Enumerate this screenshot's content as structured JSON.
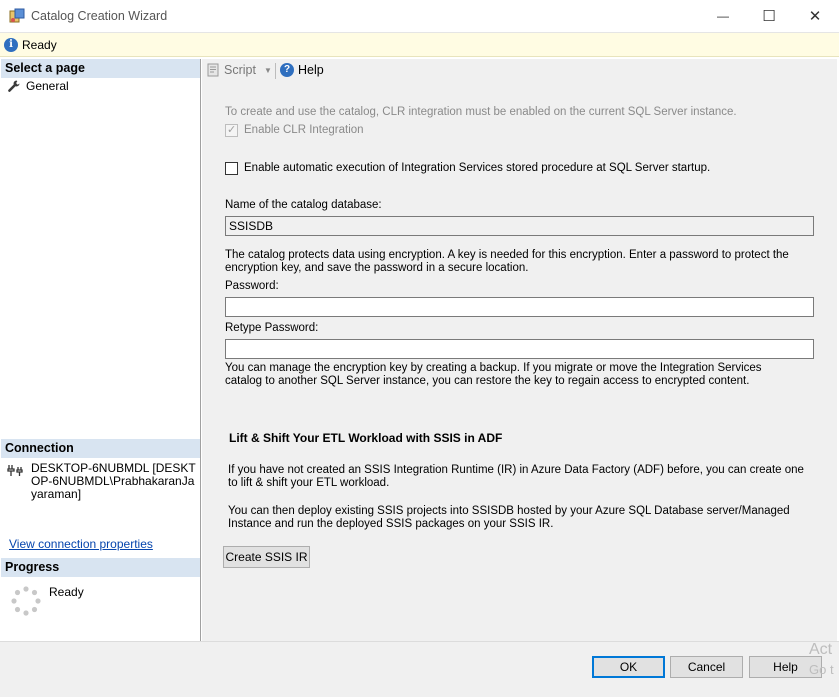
{
  "window": {
    "title": "Catalog Creation Wizard",
    "minimize_glyph": "—",
    "maximize_glyph": "☐",
    "close_glyph": "✕"
  },
  "status_bar": {
    "text": "Ready",
    "icon": "info-icon"
  },
  "left_pane": {
    "select_page_header": "Select a page",
    "pages": [
      {
        "label": "General",
        "icon": "wrench-icon"
      }
    ],
    "connection_header": "Connection",
    "connection_text": "DESKTOP-6NUBMDL [DESKTOP-6NUBMDL\\PrabhakaranJayaraman]",
    "connection_link": "View connection properties",
    "progress_header": "Progress",
    "progress_status": "Ready"
  },
  "toolbar": {
    "script_label": "Script",
    "help_label": "Help"
  },
  "form": {
    "clr_note": "To create and use the catalog, CLR integration must be enabled on the current SQL Server instance.",
    "enable_clr_label": "Enable CLR Integration",
    "auto_exec_label": "Enable automatic execution of Integration Services stored procedure at SQL Server startup.",
    "catalog_name_label": "Name of the catalog database:",
    "catalog_name_value": "SSISDB",
    "encryption_note": "The catalog protects data using encryption. A key is needed for this encryption. Enter a password to protect the encryption key, and save the password in a secure location.",
    "password_label": "Password:",
    "password_value": "",
    "retype_password_label": "Retype Password:",
    "retype_password_value": "",
    "backup_note": "You can manage the encryption key by creating a backup. If you migrate or move the Integration Services catalog to another SQL Server instance, you can restore the key to regain access to encrypted content."
  },
  "adf_section": {
    "heading": "Lift & Shift Your ETL Workload with SSIS in ADF",
    "para1": "If you have not created an SSIS Integration Runtime (IR) in Azure Data Factory (ADF) before, you can create one to lift & shift your ETL workload.",
    "para2": "You can then deploy existing SSIS projects into SSISDB hosted by your Azure SQL Database server/Managed Instance and run the deployed SSIS packages on your SSIS IR.",
    "create_button": "Create SSIS IR"
  },
  "footer": {
    "ok_label": "OK",
    "cancel_label": "Cancel",
    "help_label": "Help"
  },
  "watermark": {
    "line1": "Act",
    "line2": "Go t"
  },
  "colors": {
    "accent": "#0078d7",
    "header_bg": "#d8e4f1",
    "status_bg": "#fffce3",
    "link": "#0645ad"
  }
}
